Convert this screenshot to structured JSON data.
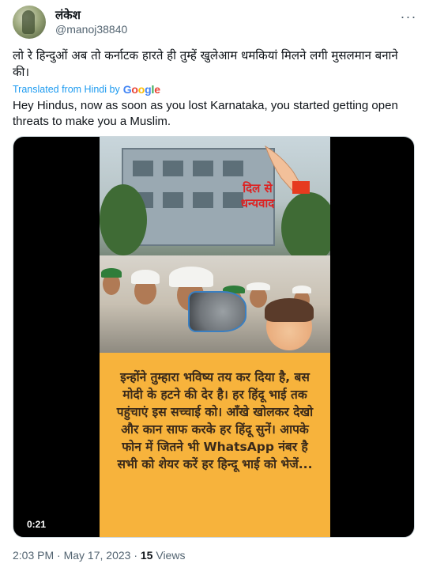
{
  "author": {
    "display_name": "लंकेश",
    "handle": "@manoj38840"
  },
  "more_icon": "more-dots-icon",
  "tweet": {
    "text": "लो रे हिन्दुओं अब तो कर्नाटक हारते ही तुम्हें खुलेआम धमकियां मिलने लगी मुसलमान बनाने की।",
    "translated_label": "Translated from Hindi by",
    "translation_provider": "Google",
    "translation": "Hey Hindus, now as soon as you lost Karnataka, you started getting open threats to make you a Muslim."
  },
  "video": {
    "overlay_title": "दिल से धन्यवाद",
    "caption": "इन्होंने तुम्हारा भविष्य तय कर दिया है, बस मोदी के हटने की देर है। हर हिंदू भाई तक पहुंचाएं इस सच्चाई को। आँखे खोलकर देखो और कान साफ करके हर हिंदू सुनें। आपके फोन में जितने भी WhatsApp नंबर है सभी को शेयर करें हर हिन्दू भाई को भेजें...",
    "timecode": "0:21",
    "caption_bg": "#f7b33c"
  },
  "meta": {
    "time": "2:03 PM",
    "sep": " · ",
    "date": "May 17, 2023",
    "views_count": "15",
    "views_label": " Views"
  }
}
